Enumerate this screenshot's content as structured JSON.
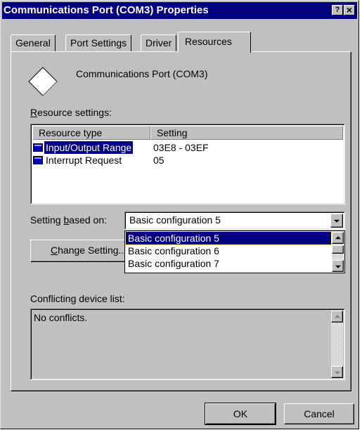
{
  "window": {
    "title": "Communications Port (COM3) Properties",
    "help_button": "?",
    "close_button": "×"
  },
  "tabs": [
    {
      "label": "General"
    },
    {
      "label": "Port Settings"
    },
    {
      "label": "Driver"
    },
    {
      "label": "Resources"
    }
  ],
  "active_tab": "Resources",
  "device": {
    "icon": "diamond-device-icon",
    "name": "Communications Port (COM3)"
  },
  "resource_settings": {
    "label_first": "R",
    "label_rest": "esource settings:",
    "columns": [
      "Resource type",
      "Setting"
    ],
    "rows": [
      {
        "type": "Input/Output Range",
        "setting": "03E8 - 03EF",
        "selected": true
      },
      {
        "type": "Interrupt Request",
        "setting": "05",
        "selected": false
      }
    ]
  },
  "setting_based_on": {
    "label_before": "Setting ",
    "label_key": "b",
    "label_after": "ased on:",
    "value": "Basic configuration 5",
    "options": [
      "Basic configuration 5",
      "Basic configuration 6",
      "Basic configuration 7"
    ],
    "highlighted_option": "Basic configuration 5"
  },
  "change_setting_button": {
    "key": "C",
    "rest": "hange Setting..."
  },
  "conflicts": {
    "label": "Conflicting device list:",
    "text": "No conflicts."
  },
  "buttons": {
    "ok": "OK",
    "cancel": "Cancel"
  },
  "colors": {
    "face": "#c0c0c0",
    "titlebar": "#000080",
    "selection": "#000080"
  }
}
